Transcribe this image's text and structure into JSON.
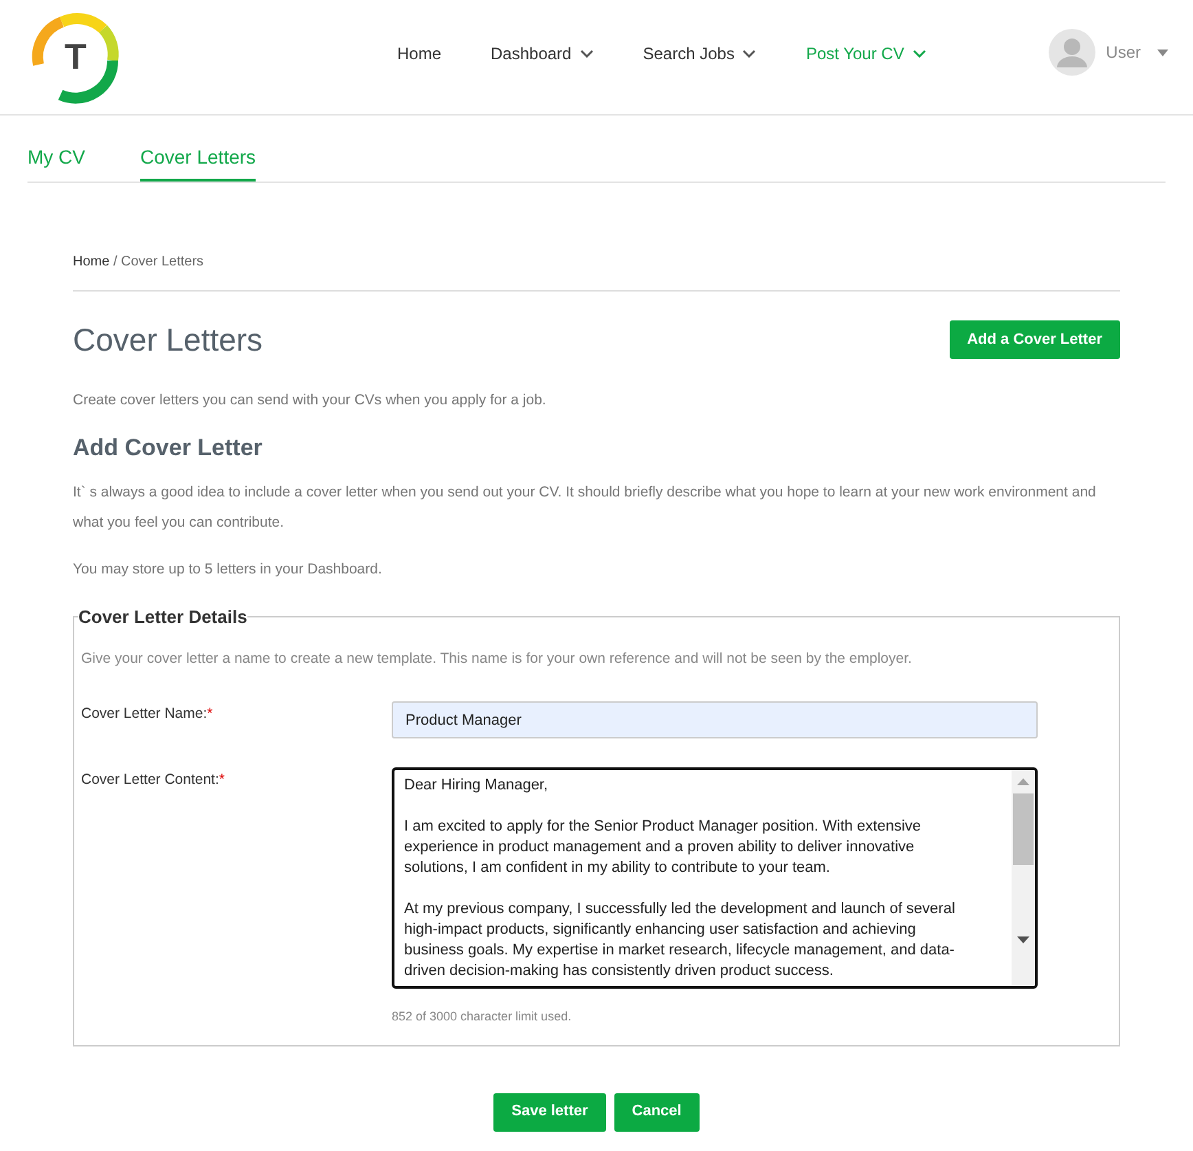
{
  "nav": {
    "items": [
      {
        "label": "Home",
        "selected": false,
        "dropdown": false
      },
      {
        "label": "Dashboard",
        "selected": false,
        "dropdown": true
      },
      {
        "label": "Search Jobs",
        "selected": false,
        "dropdown": true
      },
      {
        "label": "Post Your CV",
        "selected": true,
        "dropdown": true
      }
    ],
    "user": "User",
    "logo_letter": "T"
  },
  "tabs": [
    {
      "label": "My CV",
      "selected": false
    },
    {
      "label": "Cover Letters",
      "selected": true
    }
  ],
  "breadcrumb": {
    "link": "Home",
    "current": "/ Cover Letters"
  },
  "title": "Cover Letters",
  "add_button": "Add a Cover Letter",
  "intro": "Create cover letters you can send with your CVs when you apply for a job.",
  "section_title": "Add Cover Letter",
  "paragraphs": [
    "It` s always a good idea to include a cover letter when you send out your CV. It should briefly describe what you hope to learn at your new work environment and what you feel you can contribute.",
    "You may store up to 5 letters in your Dashboard."
  ],
  "details": {
    "legend": "Cover Letter Details",
    "hint": "Give your cover letter a name to create a new template. This name is for your own reference and will not be seen by the employer.",
    "name_label": "Cover Letter Name:",
    "name_required": "*",
    "name_value": "Product Manager",
    "content_label": "Cover Letter Content:",
    "content_required": "*",
    "content_paragraphs": [
      [
        "Dear Hiring Manager,"
      ],
      [
        "I am excited to apply for the Senior Product Manager position. With extensive",
        "experience in product management and a proven ability to deliver innovative",
        "solutions, I am confident in my ability to contribute to your team."
      ],
      [
        "At my previous company, I successfully led the development and launch of several",
        "high-impact products, significantly enhancing user satisfaction and achieving",
        "business goals. My expertise in market research, lifecycle management, and data-",
        "driven decision-making has consistently driven product success."
      ]
    ],
    "counter": "852 of 3000 character limit used."
  },
  "buttons": [
    "Save letter",
    "Cancel"
  ]
}
